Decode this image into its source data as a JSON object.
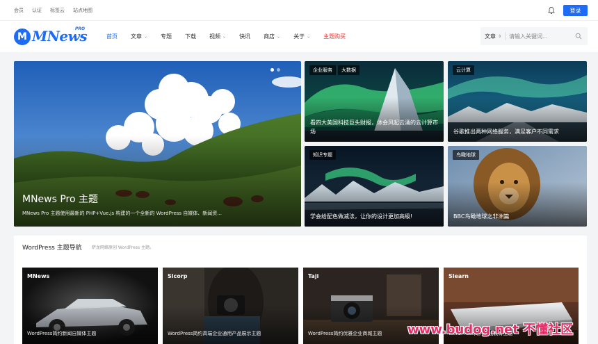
{
  "topbar": {
    "links": [
      "会员",
      "认证",
      "标签云",
      "站点地图"
    ],
    "login_label": "登录"
  },
  "logo": {
    "letter": "M",
    "text": "MNews",
    "badge": "PRO"
  },
  "nav": [
    {
      "label": "首页",
      "dropdown": false,
      "state": "active"
    },
    {
      "label": "文章",
      "dropdown": true,
      "state": ""
    },
    {
      "label": "专题",
      "dropdown": false,
      "state": ""
    },
    {
      "label": "下载",
      "dropdown": false,
      "state": ""
    },
    {
      "label": "视频",
      "dropdown": true,
      "state": ""
    },
    {
      "label": "快讯",
      "dropdown": false,
      "state": ""
    },
    {
      "label": "商店",
      "dropdown": true,
      "state": ""
    },
    {
      "label": "关于",
      "dropdown": true,
      "state": ""
    },
    {
      "label": "主题购买",
      "dropdown": false,
      "state": "highlight"
    }
  ],
  "search": {
    "scope": "文章",
    "placeholder": "请输入关键词..."
  },
  "hero": {
    "main": {
      "title": "MNews Pro 主题",
      "desc": "MNews Pro 主题使用最新的 PHP+Vue.js 构建的一个全新的 WordPress 自媒体、新闻资..."
    },
    "tiles": [
      {
        "tags": [
          "企业服务",
          "大数据"
        ],
        "caption": "看四大美国科技巨头财报，体会风起云涌的云计算市场"
      },
      {
        "tags": [
          "云计算"
        ],
        "caption": "谷歌推出两种网络服务，满足客户不同需求"
      },
      {
        "tags": [
          "知识专题"
        ],
        "caption": "学会给配色做减法，让你的设计更加高级!"
      },
      {
        "tags": [
          "鸟瞰地球"
        ],
        "caption": "BBC鸟瞰地球之非洲篇"
      }
    ]
  },
  "section": {
    "title": "WordPress 主题导航",
    "subtitle": "萨龙网络原创 WordPress 主题。",
    "cards": [
      {
        "name": "MNews",
        "desc": "WordPress简约新闻自媒体主题"
      },
      {
        "name": "Slcorp",
        "desc": "WordPress简约高端企业通用产品展示主题"
      },
      {
        "name": "Taji",
        "desc": "WordPress简约优雅企业商城主题"
      },
      {
        "name": "Slearn",
        "desc": "WordPress简约在线教育主题"
      }
    ]
  },
  "watermark": "www.budog.net 不懂社区",
  "colors": {
    "accent": "#1e6cf5",
    "highlight": "#e53935"
  }
}
